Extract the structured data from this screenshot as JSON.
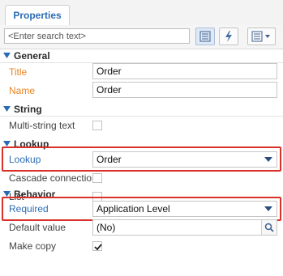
{
  "tabs": [
    {
      "label": "Properties"
    }
  ],
  "search": {
    "placeholder": "<Enter search text>"
  },
  "toolbar": {
    "icons": [
      "list-view-icon",
      "lightning-icon",
      "menu-options-icon"
    ]
  },
  "sections": {
    "general": {
      "title": "General",
      "title_label": "Title",
      "title_value": "Order",
      "name_label": "Name",
      "name_value": "Order"
    },
    "string": {
      "title": "String",
      "multi_string_label": "Multi-string text",
      "multi_string_checked": false
    },
    "lookup": {
      "title": "Lookup",
      "lookup_label": "Lookup",
      "lookup_value": "Order",
      "cascade_label": "Cascade connection",
      "cascade_checked": false,
      "list_label": "List",
      "list_checked": false
    },
    "behavior": {
      "title": "Behavior",
      "required_label": "Required",
      "required_value": "Application Level",
      "default_label": "Default value",
      "default_value": "(No)",
      "make_copy_label": "Make copy",
      "make_copy_checked": true
    }
  },
  "colors": {
    "accent": "#2a6cb4",
    "required_label": "#e8841e",
    "highlight": "#d9302a"
  }
}
